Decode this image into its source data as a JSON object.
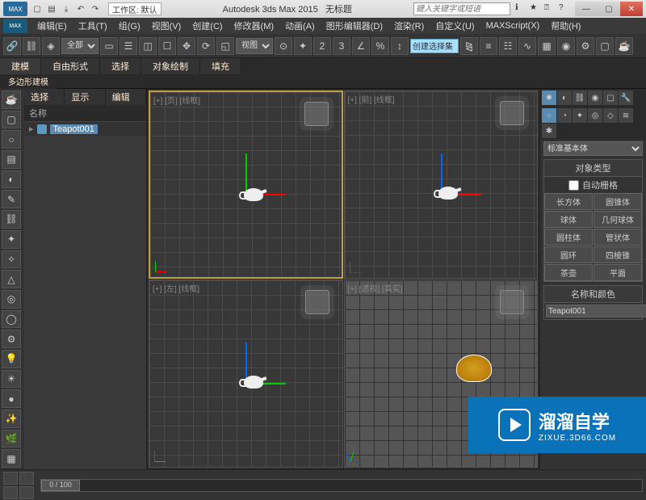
{
  "titlebar": {
    "logo": "MAX",
    "workspace_label": "工作区: 默认",
    "app_title": "Autodesk 3ds Max 2015",
    "doc_title": "无标题",
    "search_placeholder": "键入关键字或短语"
  },
  "menus": [
    "编辑(E)",
    "工具(T)",
    "组(G)",
    "视图(V)",
    "创建(C)",
    "修改器(M)",
    "动画(A)",
    "图形编辑器(D)",
    "渲染(R)",
    "自定义(U)",
    "MAXScript(X)",
    "帮助(H)"
  ],
  "toolbar": {
    "selection_filter": "全部",
    "view_dropdown": "视图",
    "spinner_label": "创建选择集"
  },
  "ribbon": {
    "tabs": [
      "建模",
      "自由形式",
      "选择",
      "对象绘制",
      "填充"
    ],
    "subtabs": [
      "多边形建模"
    ]
  },
  "scene": {
    "head": [
      "选择",
      "显示",
      "编辑"
    ],
    "column": "名称",
    "items": [
      {
        "name": "Teapot001"
      }
    ]
  },
  "viewports": {
    "top": "[+] [页] [线框]",
    "front": "[+] [前] [线框]",
    "left": "[+] [左] [线框]",
    "persp": "[+] [透视] [真实]"
  },
  "right": {
    "category": "标准基本体",
    "obj_type_head": "对象类型",
    "auto_grid": "自动栅格",
    "primitives": [
      "长方体",
      "圆锥体",
      "球体",
      "几何球体",
      "圆柱体",
      "管状体",
      "圆环",
      "四棱锥",
      "茶壶",
      "平面"
    ],
    "name_head": "名称和颜色",
    "object_name": "Teapot001"
  },
  "status": {
    "frame": "0 / 100"
  },
  "watermark": {
    "big": "溜溜自学",
    "small": "ZIXUE.3D66.COM"
  }
}
